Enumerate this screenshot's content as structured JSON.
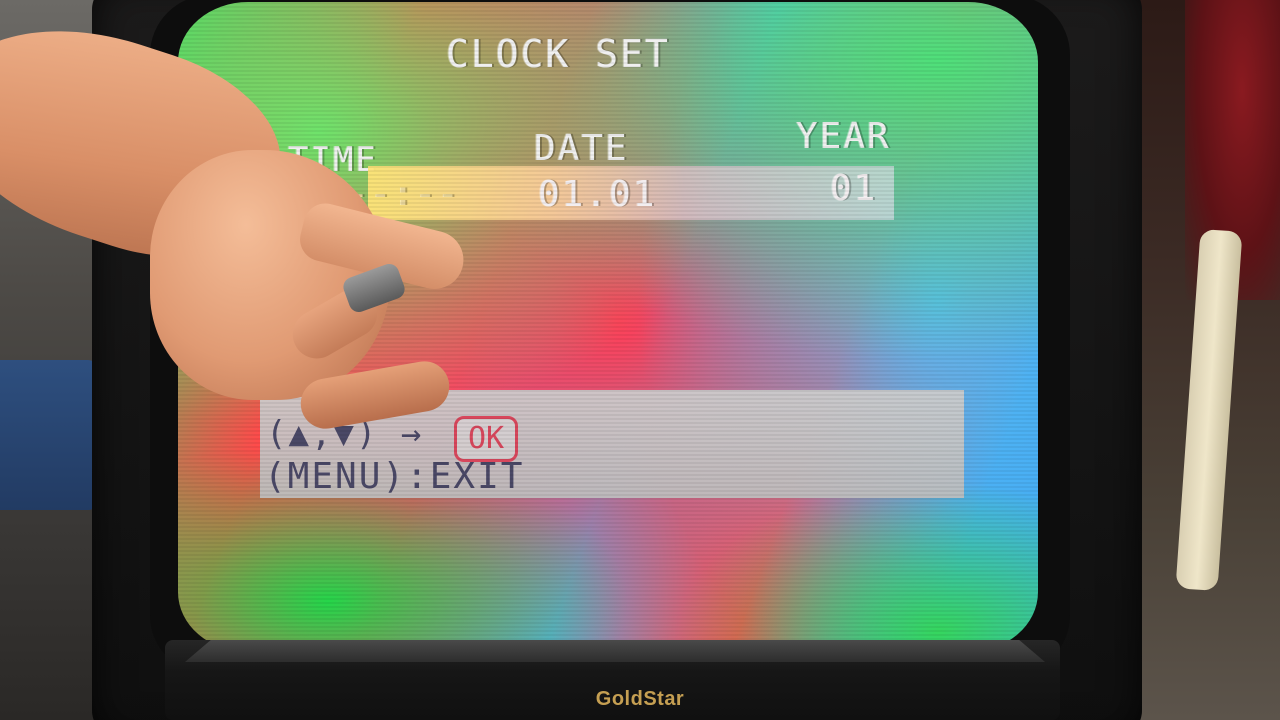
{
  "osd": {
    "title": "CLOCK SET",
    "columns": {
      "time": "TIME",
      "date": "DATE",
      "year": "YEAR"
    },
    "values": {
      "time": "--:--",
      "date": "01.01",
      "year": "01"
    },
    "hints": {
      "navigate": "(▲,▼) →",
      "ok": "OK",
      "exit_key": "(MENU)",
      "exit_label": ":EXIT"
    }
  },
  "tv": {
    "brand": "GoldStar"
  },
  "colors": {
    "brand": "#c59f52",
    "ok_outline": "#d8475c",
    "hint_text": "#4a4866"
  }
}
